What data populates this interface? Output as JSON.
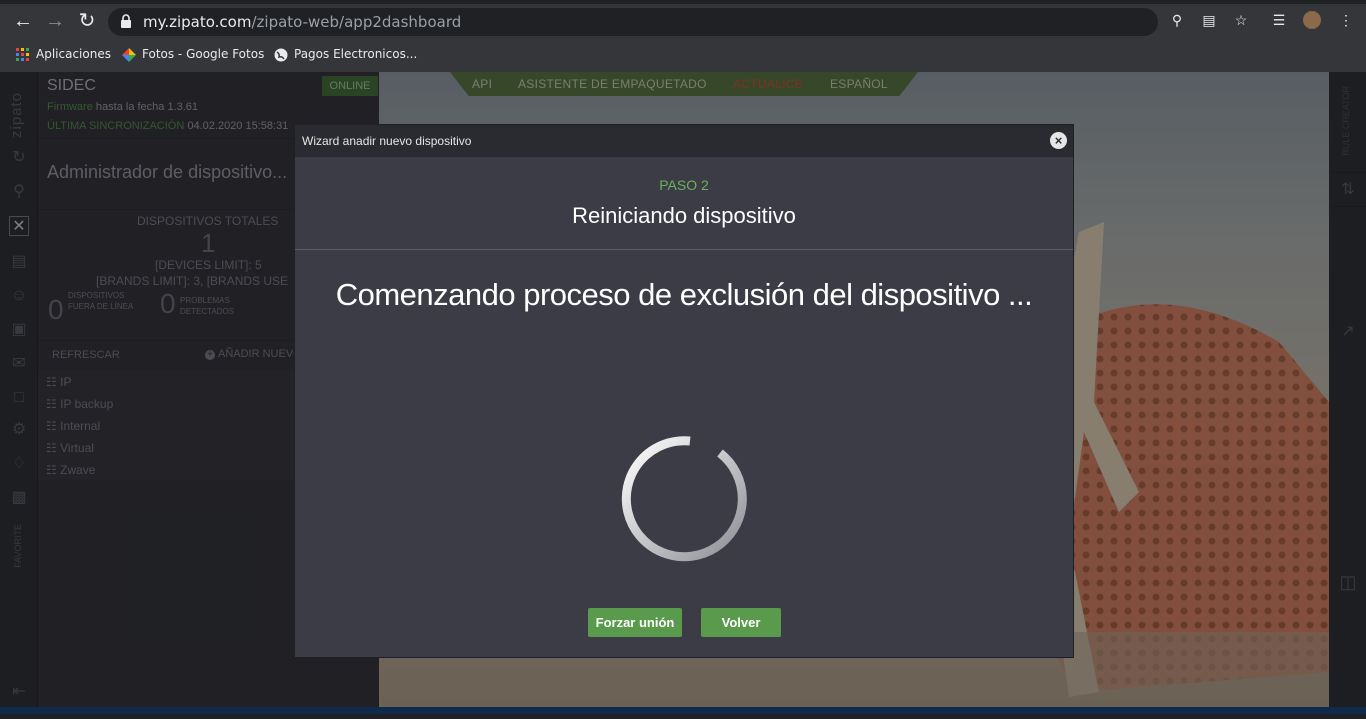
{
  "browser": {
    "url_host": "my.zipato.com",
    "url_path": "/zipato-web/app2dashboard",
    "bookmarks": [
      {
        "label": "Aplicaciones",
        "icon": "apps-grid-icon"
      },
      {
        "label": "Fotos - Google Fotos",
        "icon": "google-photos-icon"
      },
      {
        "label": "Pagos Electronicos...",
        "icon": "globe-icon"
      }
    ]
  },
  "app": {
    "brand": "zipato",
    "controller": {
      "name": "SIDEC",
      "firmware_label": "Firmware",
      "firmware_text": "hasta la fecha 1.3.61",
      "sync_label": "ÚLTIMA SINCRONIZACIÓN",
      "sync_value": "04.02.2020 15:58:31",
      "status": "ONLINE"
    },
    "topnav": [
      "API",
      "ASISTENTE DE EMPAQUETADO",
      "ACTUALICE",
      "ESPAÑOL"
    ],
    "panel": {
      "title": "Administrador de dispositivo...",
      "total_label": "DISPOSITIVOS TOTALES",
      "total_value": "1",
      "devices_limit": "[DEVICES LIMIT]: 5",
      "brands_limit": "[BRANDS LIMIT]: 3, [BRANDS USE",
      "offline_count": "0",
      "offline_label": "DISPOSITIVOS FUERA DE LÍNEA",
      "problems_count": "0",
      "problems_label": "PROBLEMAS DETECTADOS",
      "refresh": "REFRESCAR",
      "add_new": "AÑADIR NUEVO",
      "networks": [
        "IP",
        "IP backup",
        "Internal",
        "Virtual",
        "Zwave"
      ]
    },
    "strip_favorite": "FAVORITE",
    "right_strip_label": "RULE CREATOR"
  },
  "modal": {
    "title": "Wizard anadir nuevo dispositivo",
    "step": "PASO 2",
    "step_title": "Reiniciando dispositivo",
    "message": "Comenzando proceso de exclusión del dispositivo ...",
    "buttons": {
      "force": "Forzar unión",
      "back": "Volver"
    }
  },
  "colors": {
    "accent_green": "#5a9a4c",
    "step_green": "#6db15c"
  }
}
